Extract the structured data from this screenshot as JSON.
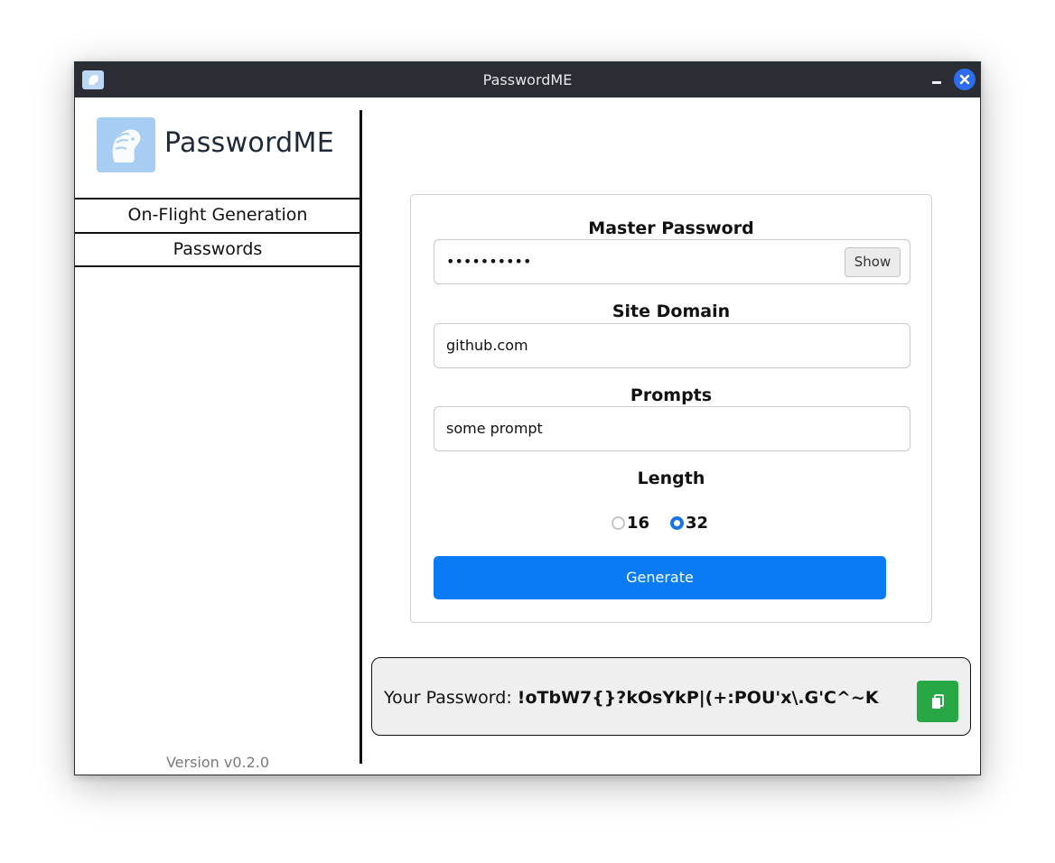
{
  "window": {
    "title": "PasswordME"
  },
  "sidebar": {
    "brand_name": "PasswordME",
    "nav_items": [
      {
        "label": "On-Flight Generation"
      },
      {
        "label": "Passwords"
      }
    ],
    "version": "Version v0.2.0"
  },
  "form": {
    "master_password": {
      "label": "Master Password",
      "value": "••••••••••",
      "show_button": "Show"
    },
    "site_domain": {
      "label": "Site Domain",
      "value": "github.com"
    },
    "prompts": {
      "label": "Prompts",
      "value": "some prompt"
    },
    "length": {
      "label": "Length",
      "options": [
        "16",
        "32"
      ],
      "selected": "32"
    },
    "generate_button": "Generate"
  },
  "result": {
    "label": "Your Password: ",
    "password": "!oTbW7{}?kOsYkP|(+:POU'x\\.G'C^~K"
  },
  "colors": {
    "titlebar": "#2a2d34",
    "primary": "#0b7bf5",
    "copy": "#28a745",
    "close": "#2f6df0"
  },
  "icons": [
    "app-icon",
    "minimize-icon",
    "close-icon",
    "lion-logo-icon",
    "copy-icon"
  ]
}
